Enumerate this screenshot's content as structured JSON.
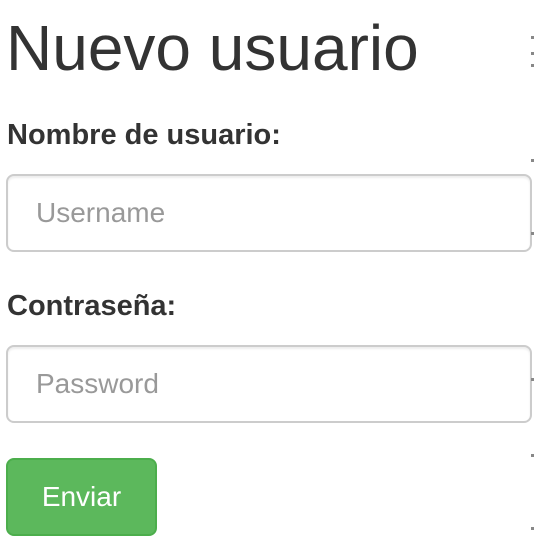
{
  "page": {
    "title": "Nuevo usuario"
  },
  "form": {
    "username_label": "Nombre de usuario:",
    "username_placeholder": "Username",
    "username_value": "",
    "password_label": "Contraseña:",
    "password_placeholder": "Password",
    "password_value": "",
    "submit_label": "Enviar"
  },
  "colors": {
    "text": "#333333",
    "placeholder": "#999999",
    "input_border": "#cccccc",
    "button_background": "#5cb85c",
    "button_border": "#4cae4c",
    "button_text": "#ffffff"
  }
}
